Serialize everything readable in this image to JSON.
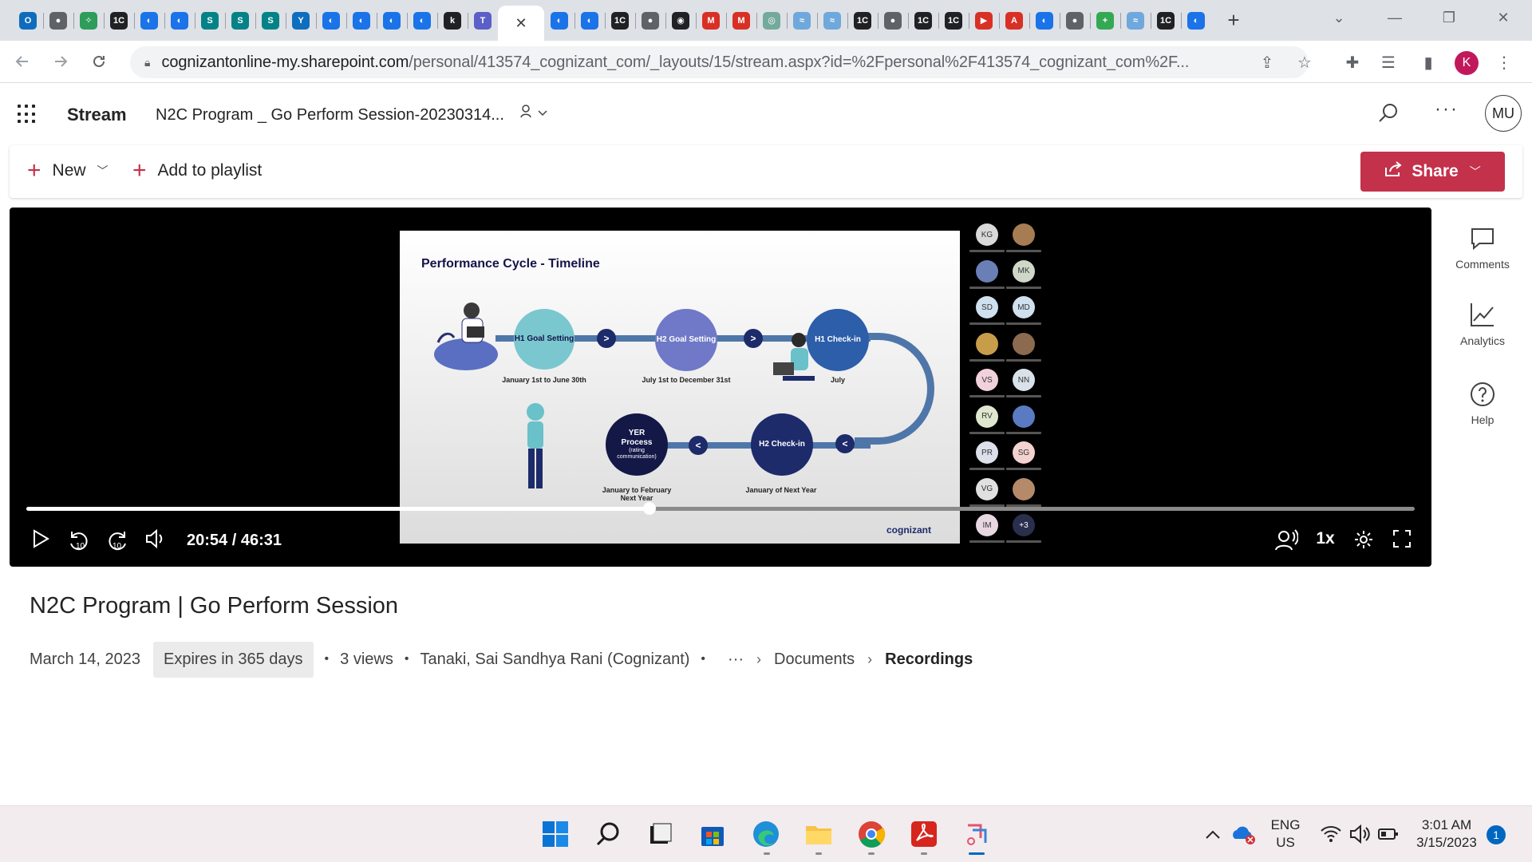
{
  "browser": {
    "tab_favicons": [
      {
        "icon": "outlook-icon",
        "color": "#0f6cbd",
        "glyph": "O"
      },
      {
        "icon": "globe-icon",
        "color": "#5f6368",
        "glyph": "●"
      },
      {
        "icon": "leaf-icon",
        "color": "#2e9c5a",
        "glyph": "✧"
      },
      {
        "icon": "onec-icon",
        "color": "#202124",
        "glyph": "1C"
      },
      {
        "icon": "edge-sync-icon",
        "color": "#1a73e8",
        "glyph": "◐"
      },
      {
        "icon": "edge-sync-icon",
        "color": "#1a73e8",
        "glyph": "◐"
      },
      {
        "icon": "sharepoint-icon",
        "color": "#038387",
        "glyph": "S"
      },
      {
        "icon": "sharepoint-icon",
        "color": "#038387",
        "glyph": "S"
      },
      {
        "icon": "sharepoint-icon",
        "color": "#038387",
        "glyph": "S"
      },
      {
        "icon": "yammer-icon",
        "color": "#106ebe",
        "glyph": "Y"
      },
      {
        "icon": "edge-sync-icon",
        "color": "#1a73e8",
        "glyph": "◐"
      },
      {
        "icon": "edge-sync-icon",
        "color": "#1a73e8",
        "glyph": "◐"
      },
      {
        "icon": "edge-sync-icon",
        "color": "#1a73e8",
        "glyph": "◐"
      },
      {
        "icon": "edge-sync-icon",
        "color": "#1a73e8",
        "glyph": "◐"
      },
      {
        "icon": "k-icon",
        "color": "#202124",
        "glyph": "k"
      },
      {
        "icon": "teams-icon",
        "color": "#5b5fc7",
        "glyph": "T"
      }
    ],
    "tab_favicons_after": [
      {
        "icon": "edge-sync-icon",
        "color": "#1a73e8",
        "glyph": "◐"
      },
      {
        "icon": "edge-sync-icon",
        "color": "#1a73e8",
        "glyph": "◐"
      },
      {
        "icon": "onec-icon",
        "color": "#202124",
        "glyph": "1C"
      },
      {
        "icon": "globe-icon",
        "color": "#5f6368",
        "glyph": "●"
      },
      {
        "icon": "github-icon",
        "color": "#202124",
        "glyph": "◉"
      },
      {
        "icon": "gmail-icon",
        "color": "#d93025",
        "glyph": "M"
      },
      {
        "icon": "gmail-icon",
        "color": "#d93025",
        "glyph": "M"
      },
      {
        "icon": "chatgpt-icon",
        "color": "#74aa9c",
        "glyph": "◎"
      },
      {
        "icon": "paper-icon",
        "color": "#6fa8dc",
        "glyph": "≈"
      },
      {
        "icon": "paper-icon",
        "color": "#6fa8dc",
        "glyph": "≈"
      },
      {
        "icon": "onec-icon",
        "color": "#202124",
        "glyph": "1C"
      },
      {
        "icon": "globe-icon",
        "color": "#5f6368",
        "glyph": "●"
      },
      {
        "icon": "onec-icon",
        "color": "#202124",
        "glyph": "1C"
      },
      {
        "icon": "onec-icon",
        "color": "#202124",
        "glyph": "1C"
      },
      {
        "icon": "play-red-icon",
        "color": "#d93025",
        "glyph": "▶"
      },
      {
        "icon": "acrobat-icon",
        "color": "#d93025",
        "glyph": "A"
      },
      {
        "icon": "edge-sync-icon",
        "color": "#1a73e8",
        "glyph": "◐"
      },
      {
        "icon": "globe-icon",
        "color": "#5f6368",
        "glyph": "●"
      },
      {
        "icon": "sheets-plus-icon",
        "color": "#34a853",
        "glyph": "+"
      },
      {
        "icon": "paper-icon",
        "color": "#6fa8dc",
        "glyph": "≈"
      },
      {
        "icon": "onec-icon",
        "color": "#202124",
        "glyph": "1C"
      },
      {
        "icon": "edge-sync-icon",
        "color": "#1a73e8",
        "glyph": "◐"
      }
    ],
    "url_host": "cognizantonline-my.sharepoint.com",
    "url_path": "/personal/413574_cognizant_com/_layouts/15/stream.aspx?id=%2Fpersonal%2F413574_cognizant_com%2F...",
    "profile_initial": "K",
    "profile_color": "#c2185b"
  },
  "app": {
    "name": "Stream",
    "doc_title": "N2C Program _ Go Perform Session-20230314...",
    "user_initials": "MU"
  },
  "commands": {
    "new_label": "New",
    "add_playlist_label": "Add to playlist",
    "share_label": "Share",
    "accent_color": "#c4314b"
  },
  "slide": {
    "title": "Performance Cycle - Timeline",
    "nodes": {
      "h1_goal": "H1 Goal Setting",
      "h2_goal": "H2 Goal Setting",
      "h1_checkin": "H1 Check-in",
      "h2_checkin": "H2 Check-in",
      "yer_title": "YER Process",
      "yer_sub": "(rating communication)"
    },
    "labels": {
      "h1_goal": "January 1st to June 30th",
      "h2_goal": "July 1st to December 31st",
      "h1_checkin": "July",
      "h2_checkin": "January of Next Year",
      "yer": "January to February Next Year"
    },
    "logo": "cognizant"
  },
  "participants": [
    {
      "initials": "KG",
      "color": "#d9d9d9"
    },
    {
      "initials": "",
      "color": "#a67c52"
    },
    {
      "initials": "",
      "color": "#6a7fb5"
    },
    {
      "initials": "MK",
      "color": "#cfd8c8"
    },
    {
      "initials": "SD",
      "color": "#cfe0ef"
    },
    {
      "initials": "MD",
      "color": "#cfe0ef"
    },
    {
      "initials": "",
      "color": "#c89d4a"
    },
    {
      "initials": "",
      "color": "#8b6a50"
    },
    {
      "initials": "VS",
      "color": "#f1d1dc"
    },
    {
      "initials": "NN",
      "color": "#d9e2ea"
    },
    {
      "initials": "RV",
      "color": "#dfe8cf"
    },
    {
      "initials": "",
      "color": "#5a7bc1"
    },
    {
      "initials": "PR",
      "color": "#dbe0ea"
    },
    {
      "initials": "SG",
      "color": "#f3d2cf"
    },
    {
      "initials": "VG",
      "color": "#e0e0e0"
    },
    {
      "initials": "",
      "color": "#b58a6a"
    },
    {
      "initials": "IM",
      "color": "#e8d6e0"
    },
    {
      "initials": "+3",
      "color": "#2b2f4e"
    }
  ],
  "player": {
    "timecode": "20:54 / 46:31",
    "progress_fraction": 0.449,
    "speed_label": "1x",
    "skip_back_label": "10",
    "skip_fwd_label": "10"
  },
  "rail": {
    "comments": "Comments",
    "analytics": "Analytics",
    "help": "Help"
  },
  "video": {
    "title": "N2C Program | Go Perform Session",
    "date": "March 14, 2023",
    "expires": "Expires in 365 days",
    "views": "3 views",
    "owner": "Tanaki, Sai Sandhya Rani (Cognizant)",
    "crumb_more": "···",
    "crumb_documents": "Documents",
    "crumb_recordings": "Recordings"
  },
  "taskbar": {
    "apps": [
      "start-icon",
      "search-icon",
      "task-view-icon",
      "store-icon",
      "edge-icon",
      "file-explorer-icon",
      "chrome-icon",
      "acrobat-icon",
      "snipping-tool-icon"
    ],
    "lang_line1": "ENG",
    "lang_line2": "US",
    "time": "3:01 AM",
    "date": "3/15/2023",
    "notification_count": "1"
  }
}
